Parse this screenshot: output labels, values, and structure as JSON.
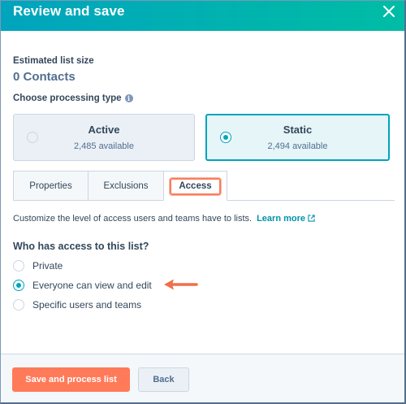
{
  "header": {
    "title": "Review and save"
  },
  "list_size": {
    "label": "Estimated list size",
    "value": "0 Contacts"
  },
  "processing": {
    "label": "Choose processing type",
    "options": [
      {
        "title": "Active",
        "available": "2,485 available",
        "selected": false
      },
      {
        "title": "Static",
        "available": "2,494 available",
        "selected": true
      }
    ]
  },
  "tabs": [
    {
      "label": "Properties",
      "active": false
    },
    {
      "label": "Exclusions",
      "active": false
    },
    {
      "label": "Access",
      "active": true
    }
  ],
  "access": {
    "description": "Customize the level of access users and teams have to lists.",
    "learn_more": "Learn more",
    "question": "Who has access to this list?",
    "options": [
      {
        "label": "Private",
        "selected": false
      },
      {
        "label": "Everyone can view and edit",
        "selected": true
      },
      {
        "label": "Specific users and teams",
        "selected": false
      }
    ]
  },
  "footer": {
    "primary_label": "Save and process list",
    "secondary_label": "Back"
  },
  "colors": {
    "header_start": "#00a4bd",
    "header_end": "#00bda5",
    "accent": "#00a4bd",
    "primary_button": "#ff7a59",
    "link": "#0091ae"
  },
  "icons": [
    "close-icon",
    "info-icon",
    "external-link-icon",
    "arrow-annotation-icon"
  ]
}
